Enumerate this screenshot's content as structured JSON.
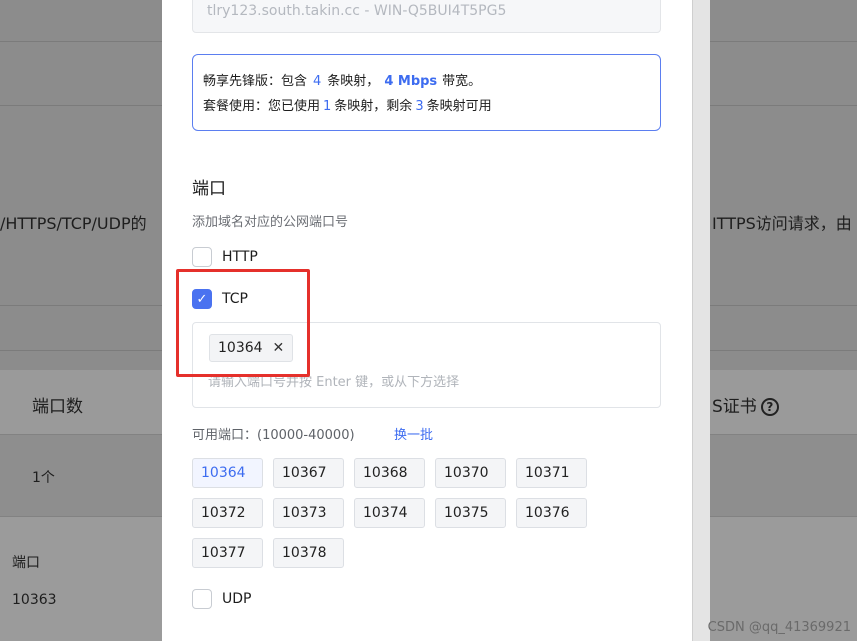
{
  "background": {
    "fragment_left": "/HTTPS/TCP/UDP的",
    "fragment_right": "ITTPS访问请求，由",
    "col_ports": "端口数",
    "col_cert": "S证书",
    "ports_count": "1个",
    "lower_label": "端口",
    "lower_value": "10363"
  },
  "host_field": {
    "value": "tlry123.south.takin.cc - WIN-Q5BUI4T5PG5"
  },
  "info": {
    "line1_prefix": "畅享先锋版：包含",
    "mapping_count": "4",
    "line1_mid": "条映射，",
    "bandwidth": "4 Mbps",
    "line1_suffix": "带宽。",
    "line2_prefix": "套餐使用：您已使用",
    "used": "1",
    "line2_mid": "条映射，剩余",
    "remaining": "3",
    "line2_suffix": "条映射可用"
  },
  "ports_section": {
    "title": "端口",
    "subtitle": "添加域名对应的公网端口号",
    "http_label": "HTTP",
    "tcp_label": "TCP",
    "udp_label": "UDP",
    "selected_tag": "10364",
    "tag_remove_glyph": "✕",
    "input_placeholder": "请输入端口号并按 Enter 键，或从下方选择",
    "available_label": "可用端口：(10000-40000)",
    "refresh_label": "换一批",
    "available_ports": [
      "10364",
      "10367",
      "10368",
      "10370",
      "10371",
      "10372",
      "10373",
      "10374",
      "10375",
      "10376",
      "10377",
      "10378"
    ],
    "http_checked": false,
    "tcp_checked": true,
    "udp_checked": false
  },
  "watermark": "CSDN @qq_41369921",
  "colors": {
    "accent": "#3d6cf0",
    "highlight_outline": "#e5302b"
  }
}
